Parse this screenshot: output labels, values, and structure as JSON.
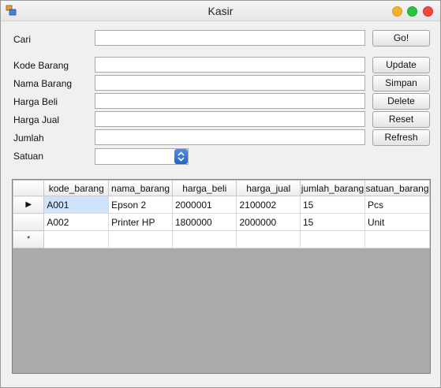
{
  "window": {
    "title": "Kasir"
  },
  "form": {
    "cari_label": "Cari",
    "kode_label": "Kode Barang",
    "nama_label": "Nama Barang",
    "harga_beli_label": "Harga Beli",
    "harga_jual_label": "Harga Jual",
    "jumlah_label": "Jumlah",
    "satuan_label": "Satuan",
    "cari_value": "",
    "kode_value": "",
    "nama_value": "",
    "harga_beli_value": "",
    "harga_jual_value": "",
    "jumlah_value": "",
    "satuan_value": ""
  },
  "buttons": {
    "go": "Go!",
    "update": "Update",
    "simpan": "Simpan",
    "delete": "Delete",
    "reset": "Reset",
    "refresh": "Refresh"
  },
  "grid": {
    "columns": [
      "kode_barang",
      "nama_barang",
      "harga_beli",
      "harga_jual",
      "jumlah_barang",
      "satuan_barang"
    ],
    "rows": [
      [
        "A001",
        "Epson 2",
        "2000001",
        "2100002",
        "15",
        "Pcs"
      ],
      [
        "A002",
        "Printer HP",
        "1800000",
        "2000000",
        "15",
        "Unit"
      ]
    ],
    "current_row_marker": "▶",
    "new_row_marker": "*"
  },
  "colors": {
    "traffic_yellow": "#f4b22a",
    "traffic_green": "#2bc43d",
    "traffic_red": "#f0493e",
    "combo_accent": "#2f6fd6",
    "selected_cell": "#cfe4fb"
  }
}
